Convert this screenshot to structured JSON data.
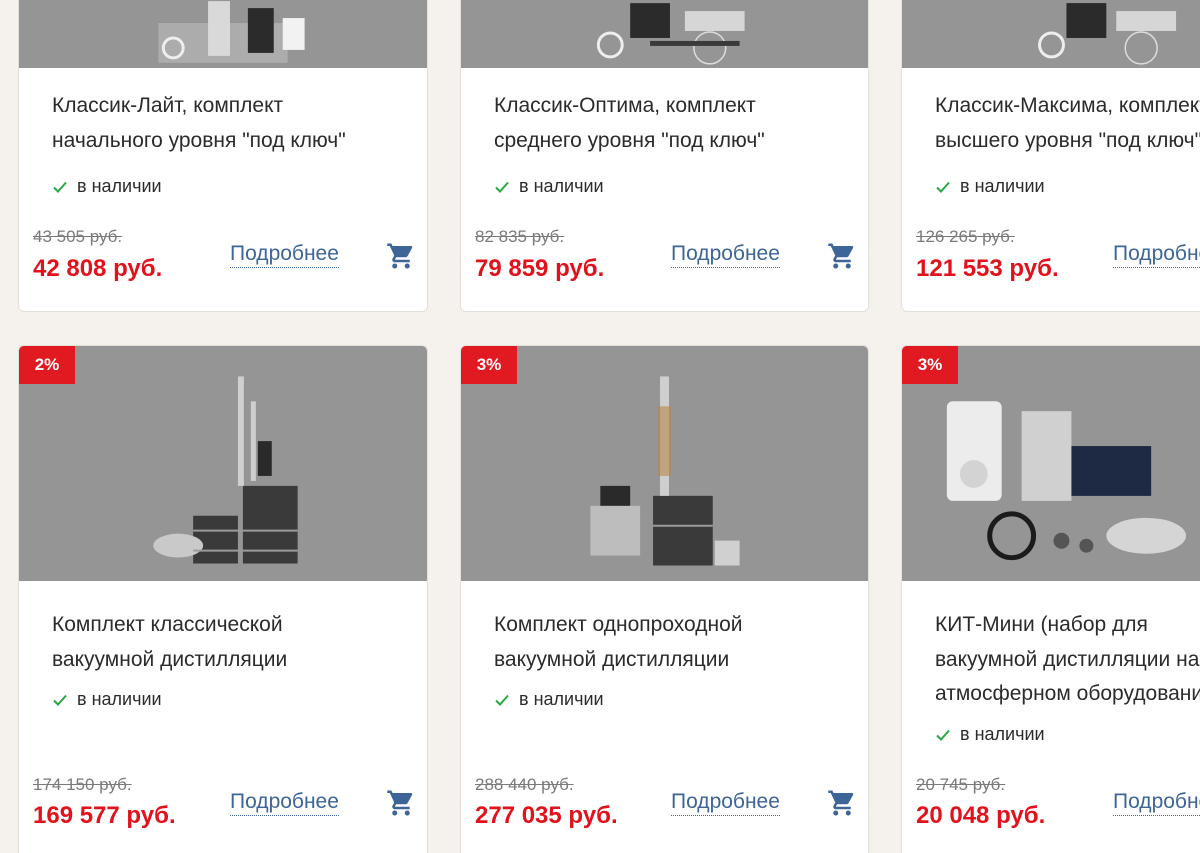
{
  "stock_label": "в наличии",
  "more_label": "Подробнее",
  "colors": {
    "price": "#e1121b",
    "link": "#3d6598",
    "badge": "#e11a22",
    "check": "#29a745",
    "photo_bg": "#959595"
  },
  "row1": [
    {
      "title_line1": "Классик-Лайт, комплект",
      "title_line2": "начального уровня \"под ключ\"",
      "old_price": "43 505 руб.",
      "price": "42 808 руб."
    },
    {
      "title_line1": "Классик-Оптима, комплект",
      "title_line2": "среднего уровня \"под ключ\"",
      "old_price": "82 835 руб.",
      "price": "79 859 руб."
    },
    {
      "title_line1": "Классик-Максима, комплект",
      "title_line2": "высшего уровня \"под ключ\"",
      "old_price": "126 265 руб.",
      "price": "121 553 руб."
    }
  ],
  "row2": [
    {
      "badge": "2%",
      "title_line1": "Комплект классической",
      "title_line2": "вакуумной дистилляции",
      "old_price": "174 150 руб.",
      "price": "169 577 руб."
    },
    {
      "badge": "3%",
      "title_line1": "Комплект однопроходной",
      "title_line2": "вакуумной дистилляции",
      "old_price": "288 440 руб.",
      "price": "277 035 руб."
    },
    {
      "badge": "3%",
      "title_line1": "КИТ-Мини (набор для",
      "title_line2": "вакуумной дистилляции на",
      "title_line3": "атмосферном оборудовании)",
      "old_price": "20 745 руб.",
      "price": "20 048 руб."
    }
  ],
  "icons": {
    "cart": "cart-icon",
    "heart": "heart-icon",
    "check": "check-icon"
  }
}
